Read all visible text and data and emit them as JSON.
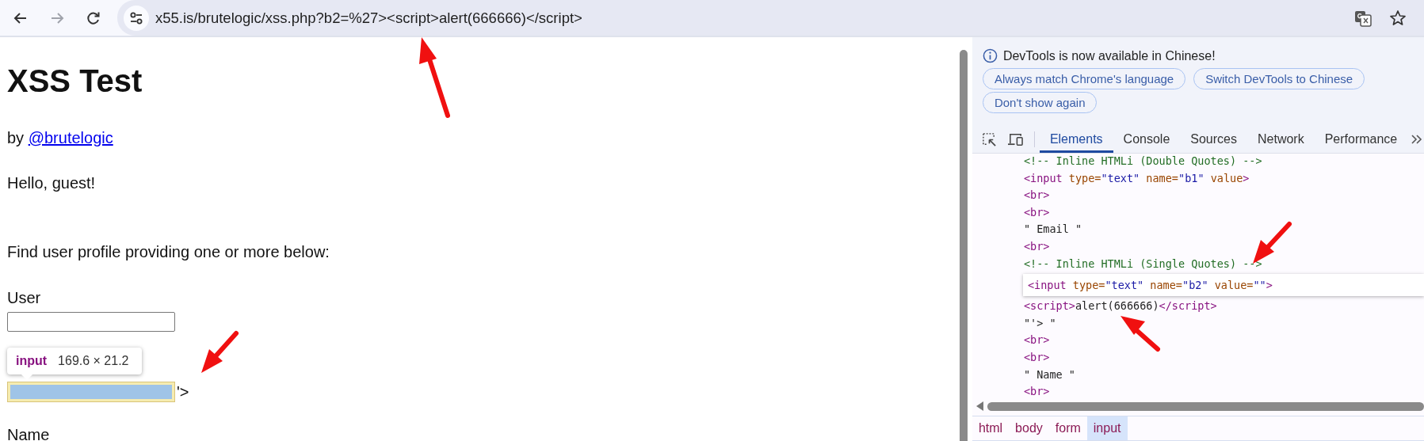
{
  "browser": {
    "back_disabled": false,
    "forward_disabled": true,
    "url": "x55.is/brutelogic/xss.php?b2=%27><script>alert(666666)</script>"
  },
  "page": {
    "title": "XSS Test",
    "byline_prefix": "by",
    "byline_link": "@brutelogic",
    "greeting": "Hello, guest!",
    "instructions": "Find user profile providing one or more below:",
    "user_label": "User",
    "injected_suffix": "'>",
    "next_label": "Name"
  },
  "inspect_tooltip": {
    "tag": "input",
    "size": "169.6 × 21.2"
  },
  "devtools": {
    "notice": "DevTools is now available in Chinese!",
    "notice_buttons": [
      "Always match Chrome's language",
      "Switch DevTools to Chinese",
      "Don't show again"
    ],
    "tabs": [
      {
        "label": "Elements",
        "selected": true
      },
      {
        "label": "Console",
        "selected": false
      },
      {
        "label": "Sources",
        "selected": false
      },
      {
        "label": "Network",
        "selected": false
      },
      {
        "label": "Performance",
        "selected": false
      }
    ],
    "code_lines": [
      {
        "selected": false,
        "tokens": [
          {
            "kind": "comment",
            "text": "<!-- Inline HTMLi (Double Quotes) -->"
          }
        ]
      },
      {
        "selected": false,
        "tokens": [
          {
            "kind": "tag",
            "text": "<input"
          },
          {
            "kind": "attr",
            "text": " type="
          },
          {
            "kind": "value",
            "text": "\"text\""
          },
          {
            "kind": "attr",
            "text": " name="
          },
          {
            "kind": "value",
            "text": "\"b1\""
          },
          {
            "kind": "attr",
            "text": " value"
          },
          {
            "kind": "tag",
            "text": ">"
          }
        ]
      },
      {
        "selected": false,
        "tokens": [
          {
            "kind": "tag",
            "text": "<br>"
          }
        ]
      },
      {
        "selected": false,
        "tokens": [
          {
            "kind": "tag",
            "text": "<br>"
          }
        ]
      },
      {
        "selected": false,
        "tokens": [
          {
            "kind": "text",
            "text": "\" Email \""
          }
        ]
      },
      {
        "selected": false,
        "tokens": [
          {
            "kind": "tag",
            "text": "<br>"
          }
        ]
      },
      {
        "selected": false,
        "tokens": [
          {
            "kind": "comment",
            "text": "<!-- Inline HTMLi (Single Quotes) -->"
          }
        ]
      },
      {
        "selected": true,
        "tokens": [
          {
            "kind": "tag",
            "text": "<input"
          },
          {
            "kind": "attr",
            "text": " type="
          },
          {
            "kind": "value",
            "text": "\"text\""
          },
          {
            "kind": "attr",
            "text": " name="
          },
          {
            "kind": "value",
            "text": "\"b2\""
          },
          {
            "kind": "attr",
            "text": " value="
          },
          {
            "kind": "value",
            "text": "\"\""
          },
          {
            "kind": "tag",
            "text": ">"
          }
        ]
      },
      {
        "selected": false,
        "tokens": [
          {
            "kind": "tag",
            "text": "<script>"
          },
          {
            "kind": "text",
            "text": "alert(666666)"
          },
          {
            "kind": "tag",
            "text": "</script>"
          }
        ]
      },
      {
        "selected": false,
        "tokens": [
          {
            "kind": "text",
            "text": "\"'> \""
          }
        ]
      },
      {
        "selected": false,
        "tokens": [
          {
            "kind": "tag",
            "text": "<br>"
          }
        ]
      },
      {
        "selected": false,
        "tokens": [
          {
            "kind": "tag",
            "text": "<br>"
          }
        ]
      },
      {
        "selected": false,
        "tokens": [
          {
            "kind": "text",
            "text": "\" Name \""
          }
        ]
      },
      {
        "selected": false,
        "tokens": [
          {
            "kind": "tag",
            "text": "<br>"
          }
        ]
      }
    ],
    "breadcrumbs": [
      {
        "label": "html",
        "selected": false
      },
      {
        "label": "body",
        "selected": false
      },
      {
        "label": "form",
        "selected": false
      },
      {
        "label": "input",
        "selected": true
      }
    ]
  }
}
